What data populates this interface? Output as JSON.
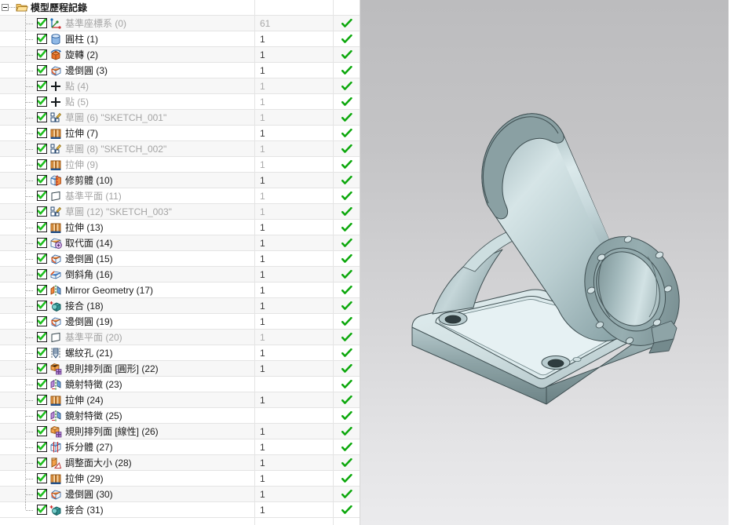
{
  "window": {
    "title": "模型歷程記錄"
  },
  "tree": {
    "root": {
      "label": "模型歷程記錄",
      "icon": "folder-open-icon",
      "expanded": true
    },
    "columns": {
      "name": "",
      "value": "",
      "status": ""
    },
    "items": [
      {
        "label": "基準座標系 (0)",
        "icon": "datum-csys-icon",
        "value": "61",
        "checked": true,
        "status": "check-green",
        "dim": true
      },
      {
        "label": "圓柱 (1)",
        "icon": "cylinder-icon",
        "value": "1",
        "checked": true,
        "status": "check-green",
        "dim": false
      },
      {
        "label": "旋轉 (2)",
        "icon": "revolve-icon",
        "value": "1",
        "checked": true,
        "status": "check-green",
        "dim": false
      },
      {
        "label": "邊倒圓 (3)",
        "icon": "edge-blend-icon",
        "value": "1",
        "checked": true,
        "status": "check-green",
        "dim": false
      },
      {
        "label": "點 (4)",
        "icon": "point-icon",
        "value": "1",
        "checked": true,
        "status": "check-green",
        "dim": true
      },
      {
        "label": "點 (5)",
        "icon": "point-icon",
        "value": "1",
        "checked": true,
        "status": "check-green",
        "dim": true
      },
      {
        "label": "草圖 (6) \"SKETCH_001\"",
        "icon": "sketch-icon",
        "value": "1",
        "checked": true,
        "status": "check-green",
        "dim": true
      },
      {
        "label": "拉伸 (7)",
        "icon": "extrude-icon",
        "value": "1",
        "checked": true,
        "status": "check-green",
        "dim": false
      },
      {
        "label": "草圖 (8) \"SKETCH_002\"",
        "icon": "sketch-icon",
        "value": "1",
        "checked": true,
        "status": "check-green",
        "dim": true
      },
      {
        "label": "拉伸 (9)",
        "icon": "extrude-icon",
        "value": "1",
        "checked": true,
        "status": "check-green",
        "dim": true
      },
      {
        "label": "修剪體 (10)",
        "icon": "trim-body-icon",
        "value": "1",
        "checked": true,
        "status": "check-green",
        "dim": false
      },
      {
        "label": "基準平面 (11)",
        "icon": "datum-plane-icon",
        "value": "1",
        "checked": true,
        "status": "check-green",
        "dim": true
      },
      {
        "label": "草圖 (12) \"SKETCH_003\"",
        "icon": "sketch-icon",
        "value": "1",
        "checked": true,
        "status": "check-green",
        "dim": true
      },
      {
        "label": "拉伸 (13)",
        "icon": "extrude-icon",
        "value": "1",
        "checked": true,
        "status": "check-green",
        "dim": false
      },
      {
        "label": "取代面 (14)",
        "icon": "replace-face-icon",
        "value": "1",
        "checked": true,
        "status": "check-green",
        "dim": false
      },
      {
        "label": "邊倒圓 (15)",
        "icon": "edge-blend-icon",
        "value": "1",
        "checked": true,
        "status": "check-green",
        "dim": false
      },
      {
        "label": "倒斜角 (16)",
        "icon": "chamfer-icon",
        "value": "1",
        "checked": true,
        "status": "check-green",
        "dim": false
      },
      {
        "label": "Mirror Geometry (17)",
        "icon": "mirror-geometry-icon",
        "value": "1",
        "checked": true,
        "status": "check-green",
        "dim": false
      },
      {
        "label": "接合 (18)",
        "icon": "unite-icon",
        "value": "1",
        "checked": true,
        "status": "check-green",
        "dim": false
      },
      {
        "label": "邊倒圓 (19)",
        "icon": "edge-blend-icon",
        "value": "1",
        "checked": true,
        "status": "check-green",
        "dim": false
      },
      {
        "label": "基準平面 (20)",
        "icon": "datum-plane-icon",
        "value": "1",
        "checked": true,
        "status": "check-green",
        "dim": true
      },
      {
        "label": "螺紋孔 (21)",
        "icon": "threaded-hole-icon",
        "value": "1",
        "checked": true,
        "status": "check-green",
        "dim": false
      },
      {
        "label": "規則排列面 [圓形] (22)",
        "icon": "pattern-face-circular-icon",
        "value": "1",
        "checked": true,
        "status": "check-green",
        "dim": false
      },
      {
        "label": "鏡射特徵 (23)",
        "icon": "mirror-feature-icon",
        "value": "",
        "checked": true,
        "status": "check-green",
        "dim": false
      },
      {
        "label": "拉伸 (24)",
        "icon": "extrude-icon",
        "value": "1",
        "checked": true,
        "status": "check-green",
        "dim": false
      },
      {
        "label": "鏡射特徵 (25)",
        "icon": "mirror-feature-icon",
        "value": "",
        "checked": true,
        "status": "check-green",
        "dim": false
      },
      {
        "label": "規則排列面 [線性] (26)",
        "icon": "pattern-face-linear-icon",
        "value": "1",
        "checked": true,
        "status": "check-green",
        "dim": false
      },
      {
        "label": "拆分體 (27)",
        "icon": "split-body-icon",
        "value": "1",
        "checked": true,
        "status": "check-green",
        "dim": false
      },
      {
        "label": "調整面大小 (28)",
        "icon": "resize-face-icon",
        "value": "1",
        "checked": true,
        "status": "check-green",
        "dim": false
      },
      {
        "label": "拉伸 (29)",
        "icon": "extrude-icon",
        "value": "1",
        "checked": true,
        "status": "check-green",
        "dim": false
      },
      {
        "label": "邊倒圓 (30)",
        "icon": "edge-blend-icon",
        "value": "1",
        "checked": true,
        "status": "check-green",
        "dim": false
      },
      {
        "label": "接合 (31)",
        "icon": "unite-icon",
        "value": "1",
        "checked": true,
        "status": "check-green",
        "dim": false
      }
    ]
  },
  "scrollbar": {
    "up_arrow": "triangle-up-icon",
    "thumb": "scroll-thumb",
    "grip": "grip-lines-icon"
  },
  "viewport": {
    "model_name": "cylindrical-housing-bracket",
    "background_top": "#bcbcbe",
    "background_bottom": "#ebebed",
    "body_color": "#b6c6c8",
    "edge_color": "#3f4f52"
  }
}
